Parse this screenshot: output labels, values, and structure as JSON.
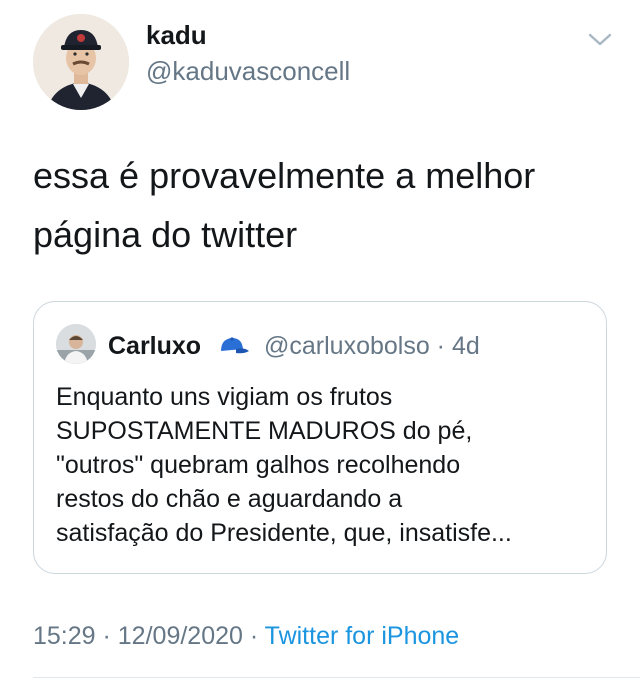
{
  "author": {
    "name": "kadu",
    "handle": "@kaduvasconcell"
  },
  "tweet": {
    "line1": "essa é provavelmente a melhor",
    "line2": "página do twitter"
  },
  "quoted": {
    "name": "Carluxo",
    "handle": "@carluxobolso · 4d",
    "lines": [
      "Enquanto uns vigiam os frutos",
      "SUPOSTAMENTE MADUROS do pé,",
      "\"outros\" quebram galhos recolhendo",
      "restos do chão e aguardando a",
      "satisfação do Presidente, que, insatisfe..."
    ]
  },
  "meta": {
    "time": "15:29",
    "sep1": " · ",
    "date": "12/09/2020",
    "sep2": " · ",
    "source": "Twitter for iPhone"
  },
  "icons": {
    "caret": "chevron-down-icon",
    "cap": "blue-cap-emoji"
  },
  "colors": {
    "link": "#1b95e0",
    "muted": "#657786",
    "border": "#ccd6dd",
    "text": "#14171a"
  }
}
